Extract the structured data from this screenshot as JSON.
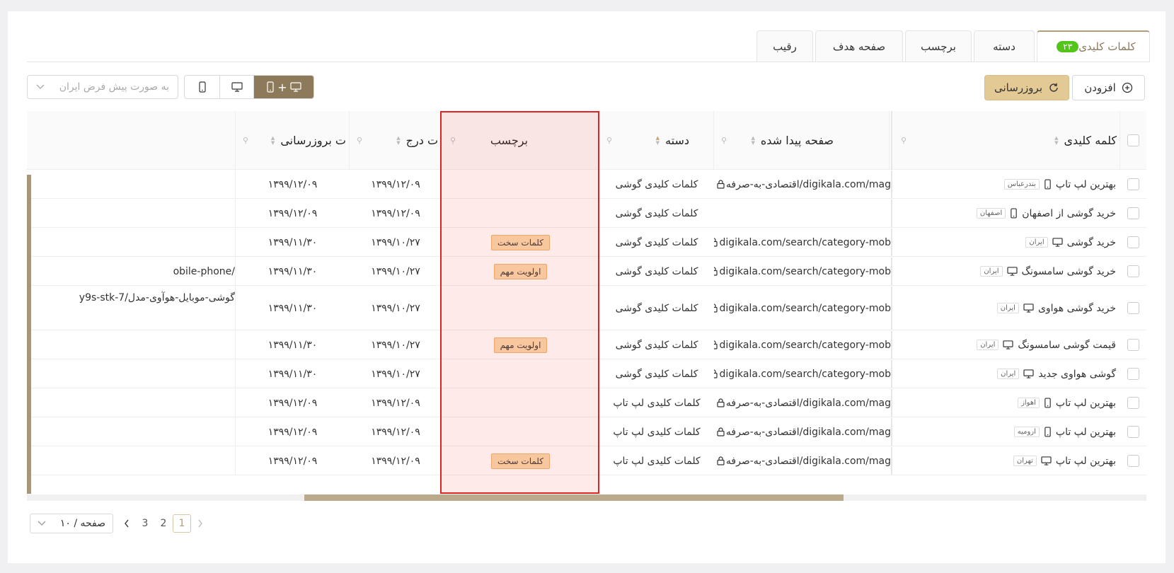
{
  "tabs": [
    {
      "label": "کلمات کلیدی",
      "badge": "۲۳"
    },
    {
      "label": "دسته"
    },
    {
      "label": "برچسب"
    },
    {
      "label": "صفحه هدف"
    },
    {
      "label": "رقیب"
    }
  ],
  "toolbar": {
    "add_label": "افزودن",
    "refresh_label": "بروزرسانی",
    "device_all_plus": "+",
    "location_placeholder": "به صورت پیش فرض ایران"
  },
  "columns": {
    "keyword": "کلمه کلیدی",
    "found_page": "صفحه پیدا شده",
    "category": "دسته",
    "tag": "برچسب",
    "insert_date": "ت درج",
    "update_date": "ت بروزرسانی"
  },
  "rows": [
    {
      "keyword": "بهترین لپ تاپ",
      "device": "mobile",
      "location": "بندرعباس",
      "page": "اقتصادی-به-صرفه/digikala.com/mag",
      "category": "کلمات کلیدی گوشی",
      "tag": "",
      "insert": "۱۳۹۹/۱۲/۰۹",
      "update": "۱۳۹۹/۱۲/۰۹",
      "extra": ""
    },
    {
      "keyword": "خرید گوشی از اصفهان",
      "device": "mobile",
      "location": "اصفهان",
      "page": "",
      "category": "کلمات کلیدی گوشی",
      "tag": "",
      "insert": "۱۳۹۹/۱۲/۰۹",
      "update": "۱۳۹۹/۱۲/۰۹",
      "extra": ""
    },
    {
      "keyword": "خرید گوشی",
      "device": "desktop",
      "location": "ایران",
      "page": "digikala.com/search/category-mob",
      "category": "کلمات کلیدی گوشی",
      "tag": "کلمات سخت",
      "insert": "۱۳۹۹/۱۰/۲۷",
      "update": "۱۳۹۹/۱۱/۳۰",
      "extra": ""
    },
    {
      "keyword": "خرید گوشی سامسونگ",
      "device": "desktop",
      "location": "ایران",
      "page": "digikala.com/search/category-mob",
      "category": "کلمات کلیدی گوشی",
      "tag": "اولویت مهم",
      "insert": "۱۳۹۹/۱۰/۲۷",
      "update": "۱۳۹۹/۱۱/۳۰",
      "extra": "obile-phone/"
    },
    {
      "keyword": "خرید گوشی هواوی",
      "device": "desktop",
      "location": "ایران",
      "page": "digikala.com/search/category-mob",
      "category": "کلمات کلیدی گوشی",
      "tag": "",
      "insert": "۱۳۹۹/۱۰/۲۷",
      "update": "۱۳۹۹/۱۱/۳۰",
      "extra": "y9s-stk-گوشی-موبایل-هوآوی-مدل/7"
    },
    {
      "keyword": "قیمت گوشی سامسونگ",
      "device": "desktop",
      "location": "ایران",
      "page": "digikala.com/search/category-mob",
      "category": "کلمات کلیدی گوشی",
      "tag": "اولویت مهم",
      "insert": "۱۳۹۹/۱۰/۲۷",
      "update": "۱۳۹۹/۱۱/۳۰",
      "extra": ""
    },
    {
      "keyword": "گوشی هواوی جدید",
      "device": "desktop",
      "location": "ایران",
      "page": "digikala.com/search/category-mob",
      "category": "کلمات کلیدی گوشی",
      "tag": "",
      "insert": "۱۳۹۹/۱۰/۲۷",
      "update": "۱۳۹۹/۱۱/۳۰",
      "extra": ""
    },
    {
      "keyword": "بهترین لپ تاپ",
      "device": "mobile",
      "location": "اهواز",
      "page": "اقتصادی-به-صرفه/digikala.com/mag",
      "category": "کلمات کلیدی لپ تاپ",
      "tag": "",
      "insert": "۱۳۹۹/۱۲/۰۹",
      "update": "۱۳۹۹/۱۲/۰۹",
      "extra": ""
    },
    {
      "keyword": "بهترین لپ تاپ",
      "device": "mobile",
      "location": "ارومیه",
      "page": "اقتصادی-به-صرفه/digikala.com/mag",
      "category": "کلمات کلیدی لپ تاپ",
      "tag": "",
      "insert": "۱۳۹۹/۱۲/۰۹",
      "update": "۱۳۹۹/۱۲/۰۹",
      "extra": ""
    },
    {
      "keyword": "بهترین لپ تاپ",
      "device": "desktop",
      "location": "تهران",
      "page": "اقتصادی-به-صرفه/digikala.com/mag",
      "category": "کلمات کلیدی لپ تاپ",
      "tag": "کلمات سخت",
      "insert": "۱۳۹۹/۱۲/۰۹",
      "update": "۱۳۹۹/۱۲/۰۹",
      "extra": ""
    }
  ],
  "pagination": {
    "page_size_label": "۱۰ / صفحه",
    "pages": [
      "1",
      "2",
      "3"
    ],
    "current": "1"
  }
}
